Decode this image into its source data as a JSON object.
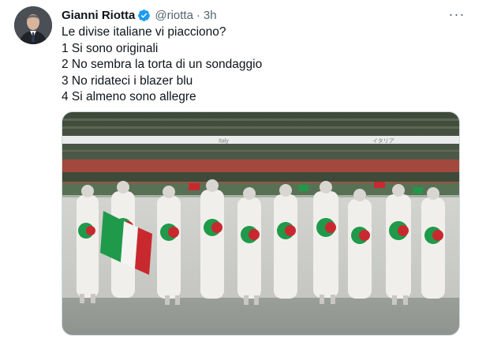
{
  "tweet": {
    "author_name": "Gianni Riotta",
    "handle": "@riotta",
    "separator": "·",
    "time": "3h",
    "more_label": "···",
    "lines": [
      "Le divise italiane vi piacciono?",
      "1 Si sono originali",
      "2 No sembra la torta di un sondaggio",
      "3 No ridateci i blazer blu",
      "4 Si almeno sono allegre"
    ],
    "banner_left": "Italy",
    "banner_right": "イタリア"
  },
  "icons": {
    "verified": "verified-badge-icon",
    "more": "more-options-icon"
  },
  "colors": {
    "verified": "#1d9bf0",
    "secondary_text": "#536471",
    "flag_green": "#1f9a4a",
    "flag_red": "#c8292f",
    "flag_white": "#f4f4f2"
  }
}
